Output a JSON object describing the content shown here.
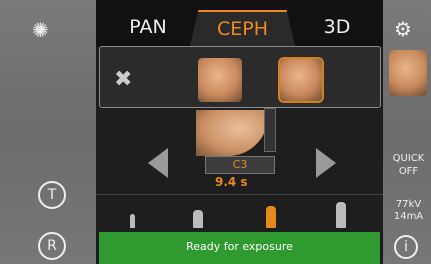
{
  "tabs": {
    "pan": "PAN",
    "ceph": "CEPH",
    "d3": "3D"
  },
  "popup": {
    "close_glyph": "✖"
  },
  "selector": {
    "value": "C3"
  },
  "exposure": {
    "time": "9.4 s"
  },
  "status": {
    "text": "Ready for exposure"
  },
  "side": {
    "quick_line1": "QUICK",
    "quick_line2": "OFF",
    "kv": "77kV",
    "ma": "14mA"
  },
  "buttons": {
    "t_label": "T",
    "r_label": "R",
    "info_label": "i"
  },
  "icons": {
    "bulb": "lightbulb-icon",
    "gear": "gear-icon",
    "close": "close-icon"
  },
  "colors": {
    "accent": "#f08a1c",
    "status_green": "#2f9a2f"
  }
}
